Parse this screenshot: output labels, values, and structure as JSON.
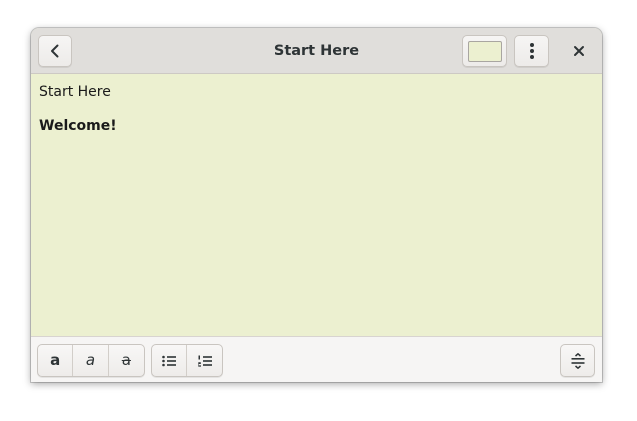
{
  "window": {
    "title": "Start Here",
    "note_color": "#ecf0d0"
  },
  "header": {
    "back_icon": "go-back-icon",
    "color_swatch": "#ecf0d0",
    "menu_icon": "vertical-dots-menu-icon",
    "close_icon": "close-icon"
  },
  "editor": {
    "lines": [
      "Start Here",
      "Welcome!"
    ]
  },
  "footer": {
    "format_buttons": [
      {
        "icon": "bold-icon",
        "glyph": "a"
      },
      {
        "icon": "italic-icon",
        "glyph": "a"
      },
      {
        "icon": "strikethrough-icon",
        "glyph": "a"
      }
    ],
    "list_buttons": [
      {
        "icon": "bulleted-list-icon"
      },
      {
        "icon": "numbered-list-icon"
      }
    ],
    "settings_icon": "text-size-settings-icon"
  }
}
